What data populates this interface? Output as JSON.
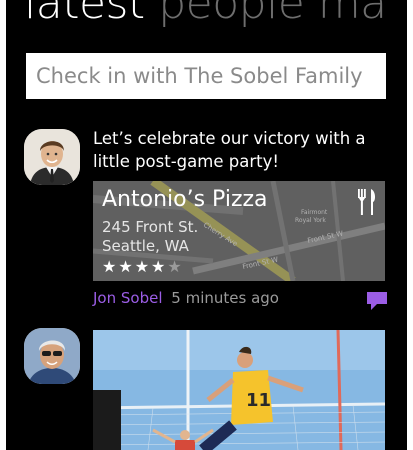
{
  "header": {
    "title_primary": "latest",
    "title_secondary": "people ma"
  },
  "checkin": {
    "placeholder": "Check in with The Sobel Family"
  },
  "posts": [
    {
      "text": "Let’s celebrate our victory with a little post-game party!",
      "place": {
        "name": "Antonio’s Pizza",
        "address_line1": "245 Front St.",
        "address_line2": "Seattle, WA",
        "rating": 4,
        "rating_max": 5,
        "category_icon": "fork-knife-icon",
        "map_labels": [
          "Cherry Ave",
          "Front St W",
          "Front St W",
          "Fairmont Royal York"
        ]
      },
      "author": "Jon Sobel",
      "time": "5 minutes ago",
      "comment_icon": "comment-icon"
    },
    {
      "photo": "soccer-photo"
    }
  ],
  "colors": {
    "accent": "#9b5de5",
    "background": "#000000",
    "secondary_text": "#9a9a9a"
  }
}
